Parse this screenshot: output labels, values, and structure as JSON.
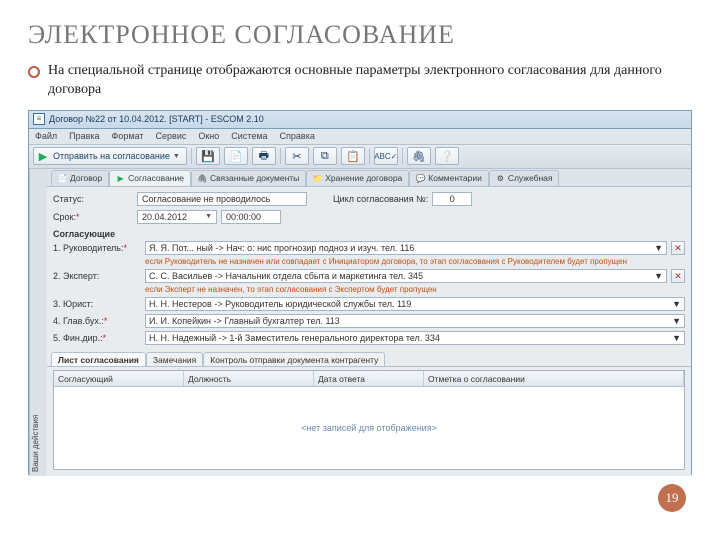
{
  "slide": {
    "title": "ЭЛЕКТРОННОЕ СОГЛАСОВАНИЕ",
    "bullet": "На специальной странице отображаются основные параметры электронного согласования для данного договора",
    "page_number": "19"
  },
  "window": {
    "title": "Договор №22 от 10.04.2012. [START] - ESCOM 2.10"
  },
  "menu": {
    "file": "Файл",
    "edit": "Правка",
    "format": "Формат",
    "service": "Сервис",
    "window": "Окно",
    "system": "Система",
    "help": "Справка"
  },
  "toolbar": {
    "send_label": "Отправить на согласование"
  },
  "tabs": {
    "doc": "Договор",
    "agree": "Согласование",
    "linked": "Связанные документы",
    "storage": "Хранение договора",
    "comments": "Комментарии",
    "service": "Служебная"
  },
  "form": {
    "status_label": "Статус:",
    "status_value": "Согласование не проводилось",
    "cycle_label": "Цикл согласования №:",
    "cycle_value": "0",
    "term_label": "Срок:",
    "term_date": "20.04.2012",
    "term_time": "00:00:00",
    "approvers_header": "Согласующие"
  },
  "approvers": {
    "r1_label": "1. Руководитель:",
    "r1_value": "Я. Я. Пот... ный -> Нач: о: нис прогнозир подноз и изуч. тел. 116",
    "r1_warn": "если Руководитель не назначен или совпадает с Инициатором договора, то этап согласования с Руководителем будет пропущен",
    "r2_label": "2. Эксперт:",
    "r2_value": "С. С. Васильев -> Начальник отдела сбыта и маркетинга тел. 345",
    "r2_warn": "если Эксперт не назначен, то этап согласования с Экспертом будет пропущен",
    "r3_label": "3. Юрист:",
    "r3_value": "Н. Н. Нестеров -> Руководитель юридической службы тел. 119",
    "r4_label": "4. Глав.бух.:",
    "r4_value": "И. И. Копейкин -> Главный бухгалтер тел. 113",
    "r5_label": "5. Фин.дир.:",
    "r5_value": "Н. Н. Надежный -> 1-й Заместитель генерального директора тел. 334"
  },
  "subtabs": {
    "sheet": "Лист согласования",
    "notes": "Замечания",
    "control": "Контроль отправки документа контрагенту"
  },
  "grid": {
    "col1": "Согласующий",
    "col2": "Должность",
    "col3": "Дата ответа",
    "col4": "Отметка о согласовании",
    "empty": "<нет записей для отображения>"
  },
  "sidetab": "Ваши действия"
}
